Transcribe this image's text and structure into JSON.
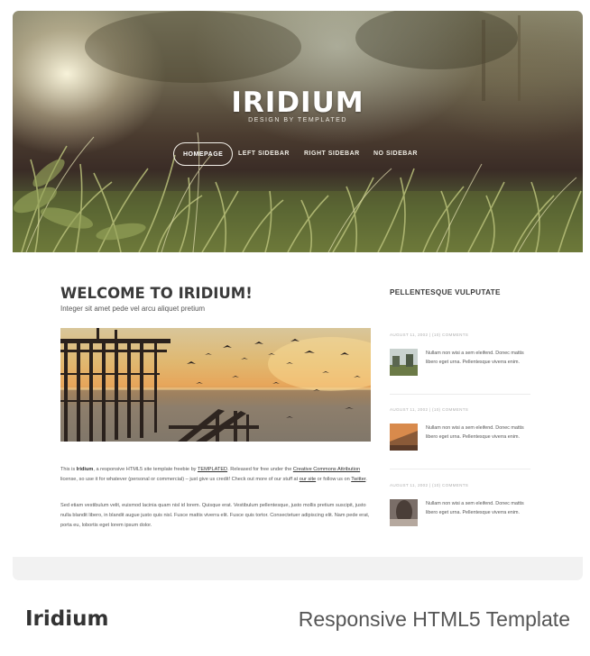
{
  "hero": {
    "title": "IRIDIUM",
    "subtitle": "DESIGN BY TEMPLATED",
    "nav": [
      {
        "label": "HOMEPAGE",
        "active": true
      },
      {
        "label": "LEFT SIDEBAR",
        "active": false
      },
      {
        "label": "RIGHT SIDEBAR",
        "active": false
      },
      {
        "label": "NO SIDEBAR",
        "active": false
      }
    ]
  },
  "main": {
    "title": "WELCOME TO IRIDIUM!",
    "subtitle": "Integer sit amet pede vel arcu aliquet pretium",
    "para1": {
      "t1": "This is ",
      "bold": "Iridium",
      "t2": ", a responsive HTML5 site template freebie by ",
      "link1": "TEMPLATED",
      "t3": ". Released for free under the ",
      "link2": "Creative Commons Attribution",
      "t4": " license, so use it for whatever (personal or commercial) – just give us credit! Check out more of our stuff at ",
      "link3": "our site",
      "t5": " or follow us on ",
      "link4": "Twitter",
      "t6": "."
    },
    "para2": "Sed etiam vestibulum velit, euismod lacinia quam nisl id lorem. Quisque erat. Vestibulum pellentesque, justo mollis pretium suscipit, justo nulla blandit libero, in blandit augue justo quis nisl. Fusce mattis viverra elit. Fusce quis tortor. Consectetuer adipiscing elit. Nam pede erat, porta eu, lobortis eget lorem ipsum dolor."
  },
  "sidebar": {
    "title": "PELLENTESQUE VULPUTATE",
    "posts": [
      {
        "meta": "AUGUST 11, 2002 | (10) COMMENTS",
        "text": "Nullam non wisi a sem eleifend. Donec mattis libero eget urna. Pellentesque viverra enim."
      },
      {
        "meta": "AUGUST 11, 2002 | (10) COMMENTS",
        "text": "Nullam non wisi a sem eleifend. Donec mattis libero eget urna. Pellentesque viverra enim."
      },
      {
        "meta": "AUGUST 11, 2002 | (10) COMMENTS",
        "text": "Nullam non wisi a sem eleifend. Donec mattis libero eget urna. Pellentesque viverra enim."
      }
    ]
  },
  "caption": {
    "title": "Iridium",
    "subtitle": "Responsive HTML5 Template"
  }
}
